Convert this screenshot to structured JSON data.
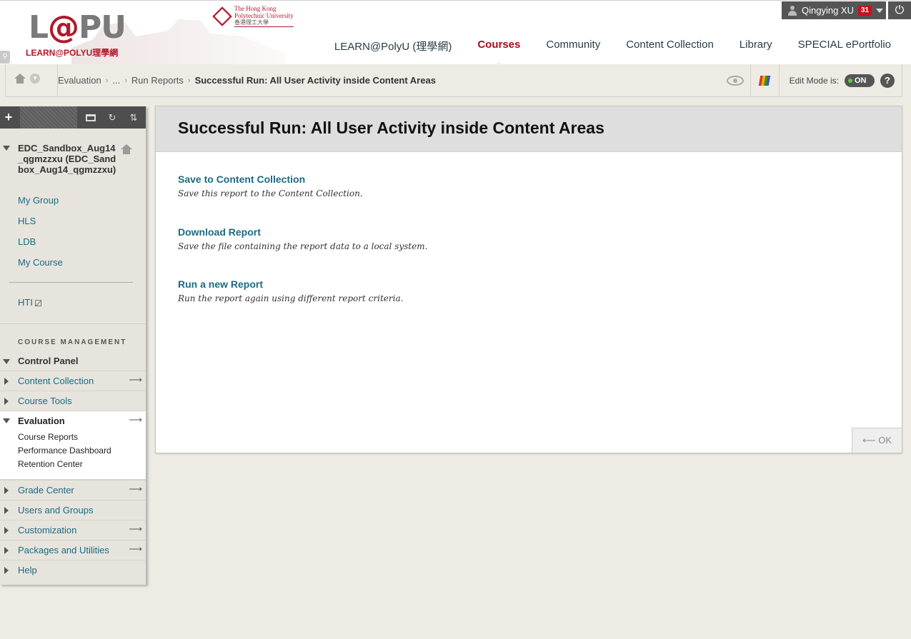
{
  "header": {
    "logo_main_left": "L",
    "logo_main_at": "@",
    "logo_main_right": "PU",
    "logo_sub": "LEARN@POLYU理學網",
    "polyu_line1": "The Hong Kong",
    "polyu_line2": "Polytechnic University",
    "polyu_line3": "香港理工大學",
    "nav": [
      "LEARN@PolyU (理學網)",
      "Courses",
      "Community",
      "Content Collection",
      "Library",
      "SPECIAL ePortfolio"
    ],
    "active_nav": "Courses",
    "user_name": "Qingying XU",
    "notification_count": "31",
    "power_glyph": "⏻"
  },
  "breadcrumb": {
    "items": [
      "Evaluation",
      "...",
      "Run Reports"
    ],
    "current": "Successful Run: All User Activity inside Content Areas",
    "edit_mode_label": "Edit Mode is:",
    "edit_mode_value": "ON",
    "help_glyph": "?"
  },
  "sidebar": {
    "course_title": "EDC_Sandbox_Aug14_qgmzzxu (EDC_Sandbox_Aug14_qgmzzxu)",
    "links": [
      "My Group",
      "HLS",
      "LDB",
      "My Course"
    ],
    "extra_link": "HTI",
    "section_heading": "COURSE MANAGEMENT",
    "control_panel": "Control Panel",
    "menu_top": [
      "Content Collection",
      "Course Tools"
    ],
    "evaluation": {
      "label": "Evaluation",
      "items": [
        "Course Reports",
        "Performance Dashboard",
        "Retention Center"
      ]
    },
    "menu_bottom": [
      "Grade Center",
      "Users and Groups",
      "Customization",
      "Packages and Utilities",
      "Help"
    ]
  },
  "main": {
    "title": "Successful Run: All User Activity inside Content Areas",
    "options": [
      {
        "label": "Save to Content Collection",
        "desc": "Save this report to the Content Collection."
      },
      {
        "label": "Download Report",
        "desc": "Save the file containing the report data to a local system."
      },
      {
        "label": "Run a new Report",
        "desc": "Run the report again using different report criteria."
      }
    ],
    "ok_label": "⟵ OK"
  },
  "colors": {
    "brand_red": "#a10e1b",
    "link_teal": "#1b6b82",
    "toggle_on": "#5bd13b"
  }
}
